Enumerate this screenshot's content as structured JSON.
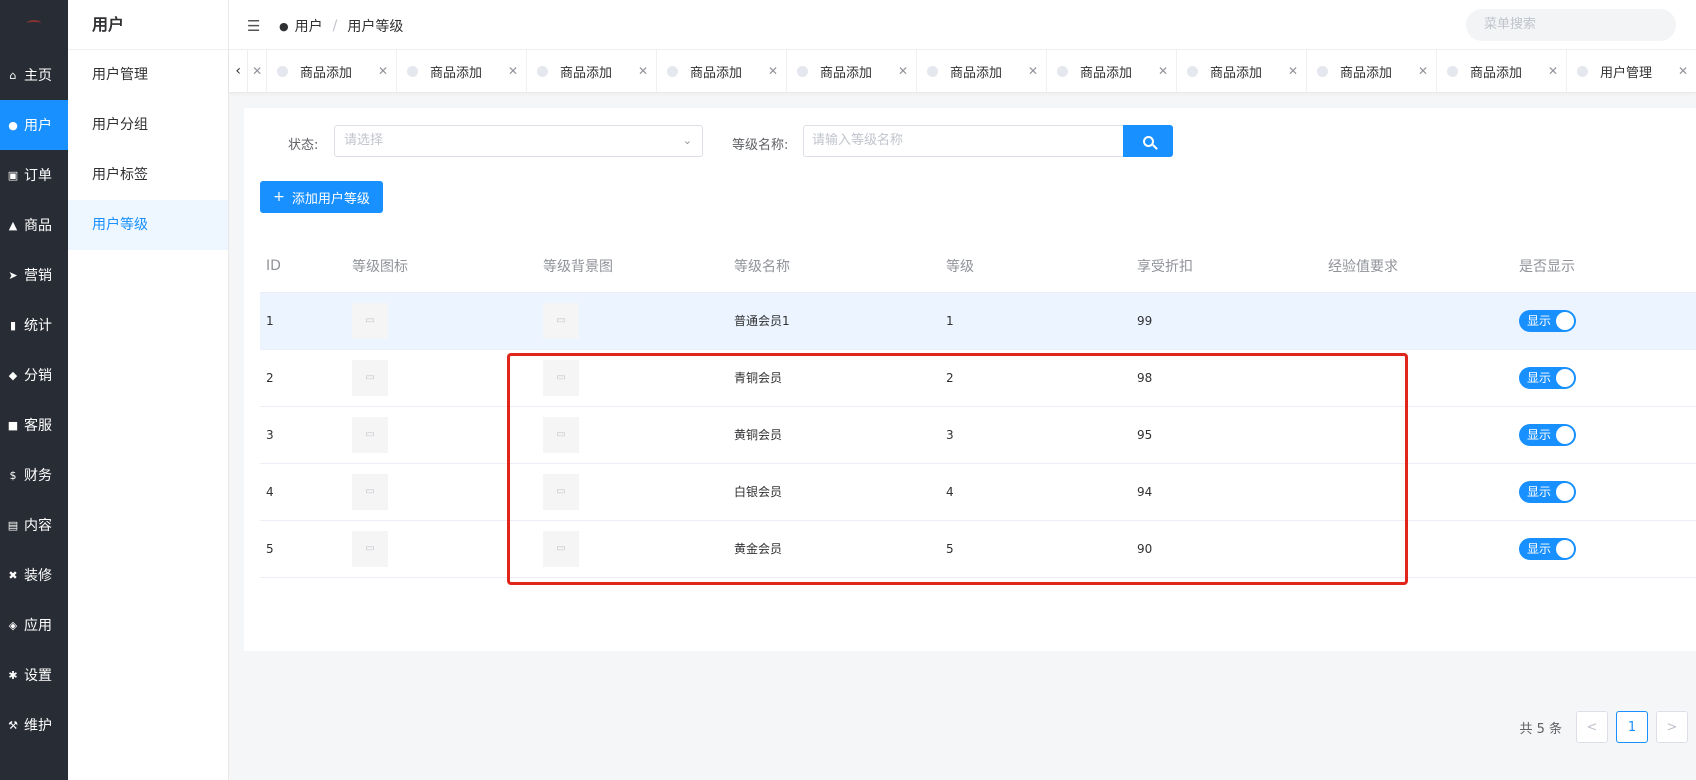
{
  "nav": {
    "items": [
      {
        "label": "主页",
        "icon": "home-icon",
        "glyph": "⌂"
      },
      {
        "label": "用户",
        "icon": "user-icon",
        "glyph": "●"
      },
      {
        "label": "订单",
        "icon": "cart-icon",
        "glyph": "▣"
      },
      {
        "label": "商品",
        "icon": "shop-icon",
        "glyph": "▲"
      },
      {
        "label": "营销",
        "icon": "send-icon",
        "glyph": "➤"
      },
      {
        "label": "统计",
        "icon": "chart-icon",
        "glyph": "▮"
      },
      {
        "label": "分销",
        "icon": "handshake-icon",
        "glyph": "◆"
      },
      {
        "label": "客服",
        "icon": "chat-icon",
        "glyph": "■"
      },
      {
        "label": "财务",
        "icon": "dollar-icon",
        "glyph": "$"
      },
      {
        "label": "内容",
        "icon": "book-icon",
        "glyph": "▤"
      },
      {
        "label": "装修",
        "icon": "tools-icon",
        "glyph": "✖"
      },
      {
        "label": "应用",
        "icon": "cube-icon",
        "glyph": "◈"
      },
      {
        "label": "设置",
        "icon": "gear-icon",
        "glyph": "✱"
      },
      {
        "label": "维护",
        "icon": "hammer-icon",
        "glyph": "⚒"
      }
    ]
  },
  "sub": {
    "title": "用户",
    "items": [
      "用户管理",
      "用户分组",
      "用户标签",
      "用户等级"
    ]
  },
  "header": {
    "crumb_root": "用户",
    "crumb_sep": "/",
    "crumb_current": "用户等级",
    "search_placeholder": "菜单搜索"
  },
  "tabs": [
    "商品添加",
    "商品添加",
    "商品添加",
    "商品添加",
    "商品添加",
    "商品添加",
    "商品添加",
    "商品添加",
    "商品添加",
    "商品添加",
    "用户管理"
  ],
  "filter": {
    "status_label": "状态:",
    "status_placeholder": "请选择",
    "name_label": "等级名称:",
    "name_placeholder": "请输入等级名称"
  },
  "add_button": "添加用户等级",
  "table": {
    "headers": [
      "ID",
      "等级图标",
      "等级背景图",
      "等级名称",
      "等级",
      "享受折扣",
      "经验值要求",
      "是否显示"
    ],
    "rows": [
      {
        "id": "1",
        "name": "普通会员1",
        "level": "1",
        "discount": "99",
        "exp": "",
        "show": "显示"
      },
      {
        "id": "2",
        "name": "青铜会员",
        "level": "2",
        "discount": "98",
        "exp": "",
        "show": "显示"
      },
      {
        "id": "3",
        "name": "黄铜会员",
        "level": "3",
        "discount": "95",
        "exp": "",
        "show": "显示"
      },
      {
        "id": "4",
        "name": "白银会员",
        "level": "4",
        "discount": "94",
        "exp": "",
        "show": "显示"
      },
      {
        "id": "5",
        "name": "黄金会员",
        "level": "5",
        "discount": "90",
        "exp": "",
        "show": "显示"
      }
    ]
  },
  "pagination": {
    "total": "共 5 条",
    "current": "1",
    "prev": "<",
    "next": ">"
  },
  "colors": {
    "accent": "#1890ff",
    "nav_bg": "#282c34",
    "highlight_box": "#e1251b"
  }
}
